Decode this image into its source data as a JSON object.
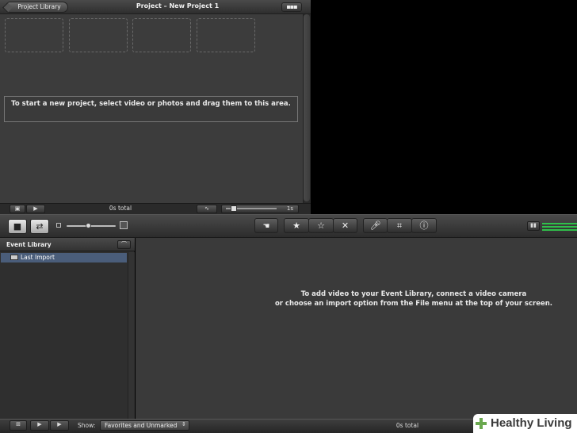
{
  "project": {
    "back_button_label": "Project Library",
    "title": "Project – New Project 1",
    "menu_button_label": "▪▪▪",
    "instruction": "To start a new project, select video or photos and drag them to this area.",
    "total": "0s total",
    "duration_label": "1s"
  },
  "toolbar": {
    "zoom_level_fraction": 0.45
  },
  "event_library": {
    "title": "Event Library",
    "items": [
      {
        "label": "Last Import"
      }
    ],
    "instruction_line1": "To add video to your Event Library, connect a video camera",
    "instruction_line2": "or choose an import option from the File menu at the top of your screen."
  },
  "bottom_bar": {
    "show_label": "Show:",
    "show_value": "Favorites and Unmarked",
    "total": "0s total"
  },
  "watermark": {
    "text": "Healthy Living"
  },
  "colors": {
    "panel": "#3c3c3c",
    "selection": "#4a5d7a",
    "meter": "#2fc04a",
    "watermark_green": "#6aa84f"
  }
}
